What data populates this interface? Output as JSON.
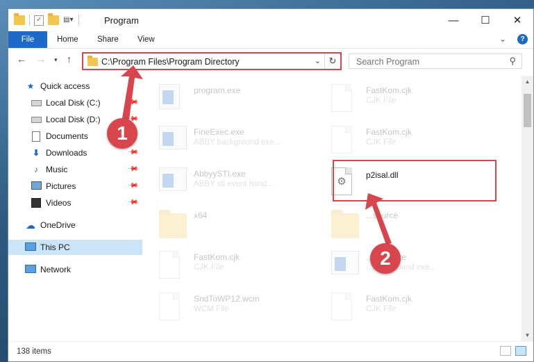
{
  "window": {
    "title": "Program",
    "controls": {
      "minimize": "—",
      "maximize": "☐",
      "close": "✕"
    }
  },
  "ribbon": {
    "tabs": [
      {
        "label": "File"
      },
      {
        "label": "Home"
      },
      {
        "label": "Share"
      },
      {
        "label": "View"
      }
    ],
    "expand": "⌄",
    "help": "?"
  },
  "address": {
    "path": "C:\\Program Files\\Program Directory",
    "dropdown": "⌄",
    "refresh": "↻"
  },
  "search": {
    "placeholder": "Search Program",
    "icon": "⚲"
  },
  "sidebar": {
    "items": [
      {
        "label": "Quick access",
        "icon": "star-icon"
      },
      {
        "label": "Local Disk (C:)",
        "icon": "drive-icon"
      },
      {
        "label": "Local Disk (D:)",
        "icon": "drive-icon"
      },
      {
        "label": "Documents",
        "icon": "documents-icon"
      },
      {
        "label": "Downloads",
        "icon": "download-icon"
      },
      {
        "label": "Music",
        "icon": "music-icon"
      },
      {
        "label": "Pictures",
        "icon": "pictures-icon"
      },
      {
        "label": "Videos",
        "icon": "videos-icon"
      },
      {
        "label": "OneDrive",
        "icon": "cloud-icon"
      },
      {
        "label": "This PC",
        "icon": "computer-icon"
      },
      {
        "label": "Network",
        "icon": "network-icon"
      }
    ]
  },
  "files": [
    {
      "name": "program.exe",
      "type": ""
    },
    {
      "name": "FastKom.cjk",
      "type": "CJK File"
    },
    {
      "name": "FineExec.exe",
      "type": "ABBY background exe..."
    },
    {
      "name": "FastKom.cjk",
      "type": "CJK File"
    },
    {
      "name": "AbbyySTI.exe",
      "type": "ABBY sti event hand..."
    },
    {
      "name": "p2isal.dll",
      "type": ""
    },
    {
      "name": "x64",
      "type": ""
    },
    {
      "name": "...source",
      "type": ""
    },
    {
      "name": "FastKom.cjk",
      "type": "CJK File"
    },
    {
      "name": "...exec.exe",
      "type": "...background exe..."
    },
    {
      "name": "SndToWP12.wcm",
      "type": "WCM File"
    },
    {
      "name": "FastKom.cjk",
      "type": "CJK File"
    }
  ],
  "status": {
    "count": "138 items"
  },
  "annotations": {
    "step1": "1",
    "step2": "2",
    "color": "#d9454d"
  }
}
